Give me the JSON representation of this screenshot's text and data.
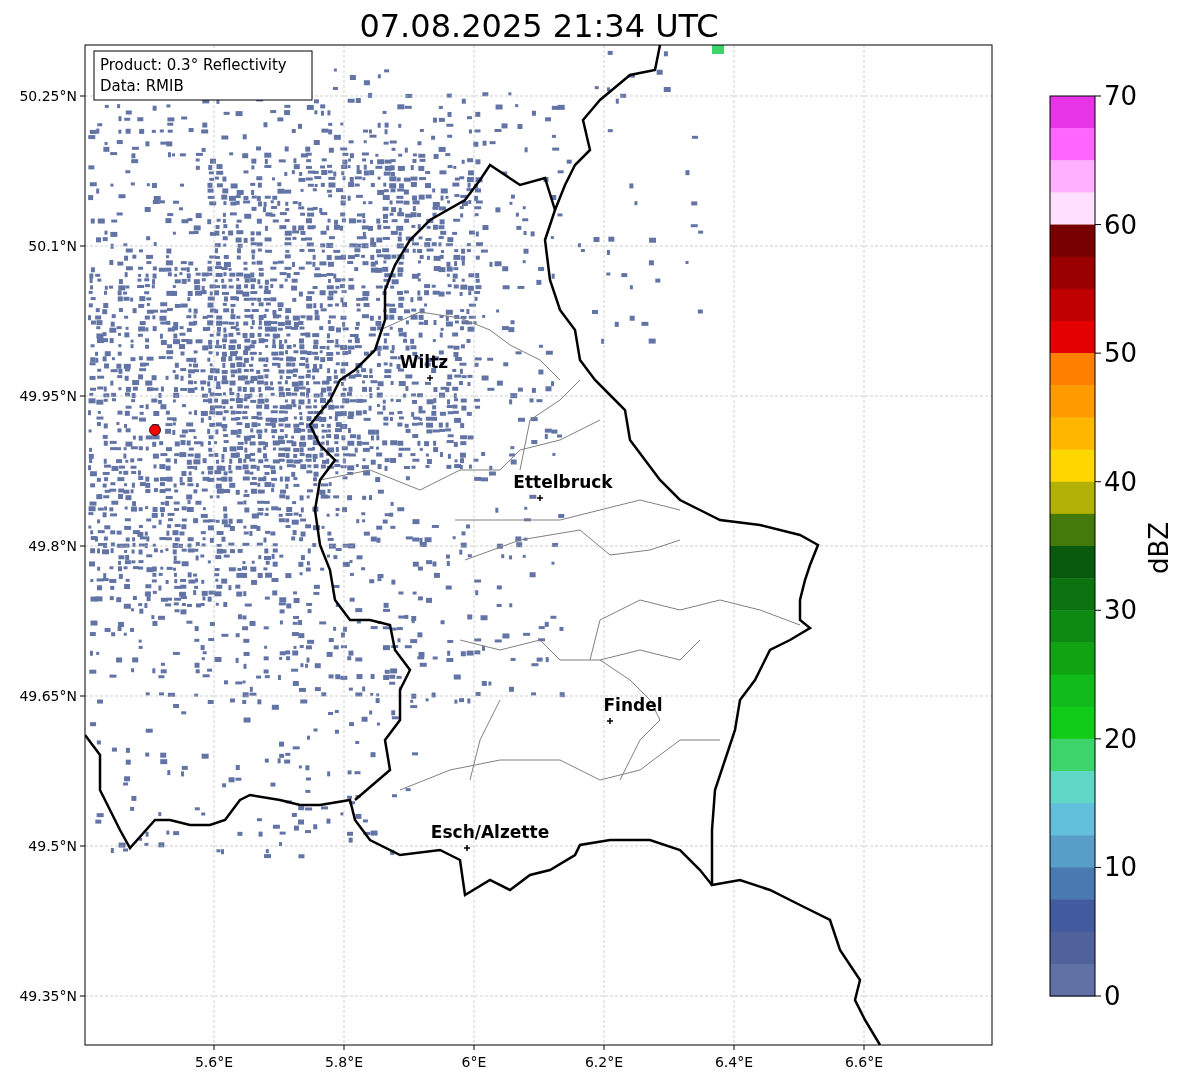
{
  "title": "07.08.2025 21:34 UTC",
  "info_box": [
    "Product: 0.3° Reflectivity",
    "Data: RMIB"
  ],
  "lat_ticks": [
    "50.25°N",
    "50.1°N",
    "49.95°N",
    "49.8°N",
    "49.65°N",
    "49.5°N",
    "49.35°N"
  ],
  "lon_ticks": [
    "5.6°E",
    "5.8°E",
    "6°E",
    "6.2°E",
    "6.4°E",
    "6.6°E"
  ],
  "cities": [
    {
      "name": "Wiltz"
    },
    {
      "name": "Ettelbruck"
    },
    {
      "name": "Findel"
    },
    {
      "name": "Esch/Alzette"
    }
  ],
  "colorbar": {
    "label": "dBZ",
    "ticks": [
      "70",
      "60",
      "50",
      "40",
      "30",
      "20",
      "10",
      "0"
    ],
    "segments": [
      {
        "color": "#e634e6"
      },
      {
        "color": "#ff66ff"
      },
      {
        "color": "#ffb0ff"
      },
      {
        "color": "#ffe0ff"
      },
      {
        "color": "#780000"
      },
      {
        "color": "#9b0000"
      },
      {
        "color": "#c00000"
      },
      {
        "color": "#e40000"
      },
      {
        "color": "#ff7f00"
      },
      {
        "color": "#ff9b00"
      },
      {
        "color": "#ffb600"
      },
      {
        "color": "#ffd700"
      },
      {
        "color": "#b3b106"
      },
      {
        "color": "#44790b"
      },
      {
        "color": "#085a0e"
      },
      {
        "color": "#0b7310"
      },
      {
        "color": "#0d8a12"
      },
      {
        "color": "#10a413"
      },
      {
        "color": "#11bb1b"
      },
      {
        "color": "#12cc1a"
      },
      {
        "color": "#3dd46c"
      },
      {
        "color": "#5fd6c6"
      },
      {
        "color": "#62bfdb"
      },
      {
        "color": "#579fc8"
      },
      {
        "color": "#4a78b0"
      },
      {
        "color": "#425a9f"
      },
      {
        "color": "#4f629c"
      },
      {
        "color": "#6171a5"
      }
    ]
  }
}
